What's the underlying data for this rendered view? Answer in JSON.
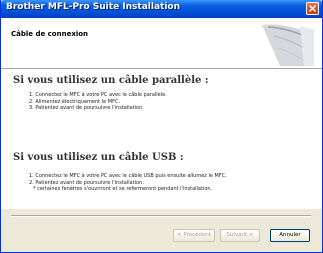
{
  "window": {
    "title": "Brother MFL-Pro Suite Installation"
  },
  "header": {
    "title": "Câble de connexion"
  },
  "sections": [
    {
      "heading": "Si vous utilisez un câble parallèle :",
      "items": [
        "1. Connectez le MFC à votre PC avec le câble parallèle.",
        "2. Alimentez électriquement le MFC.",
        "3. Patientez avant de poursuivre l'installation."
      ]
    },
    {
      "heading": "Si vous utilisez un câble USB :",
      "items": [
        "1. Connectez le MFC à votre PC avec le câble USB puis ensuite allumez le MFC.",
        "2. Patientez avant de poursuivre l'installation.",
        "   * certaines fenêtres s'ouvriront et se refermeront pendant l'installation."
      ]
    }
  ],
  "buttons": {
    "back": "< Précédent",
    "next": "Suivant >",
    "cancel": "Annuler"
  },
  "colors": {
    "titlebar": "#0250d8",
    "window_face": "#ece9d8",
    "button_border": "#003c74"
  }
}
